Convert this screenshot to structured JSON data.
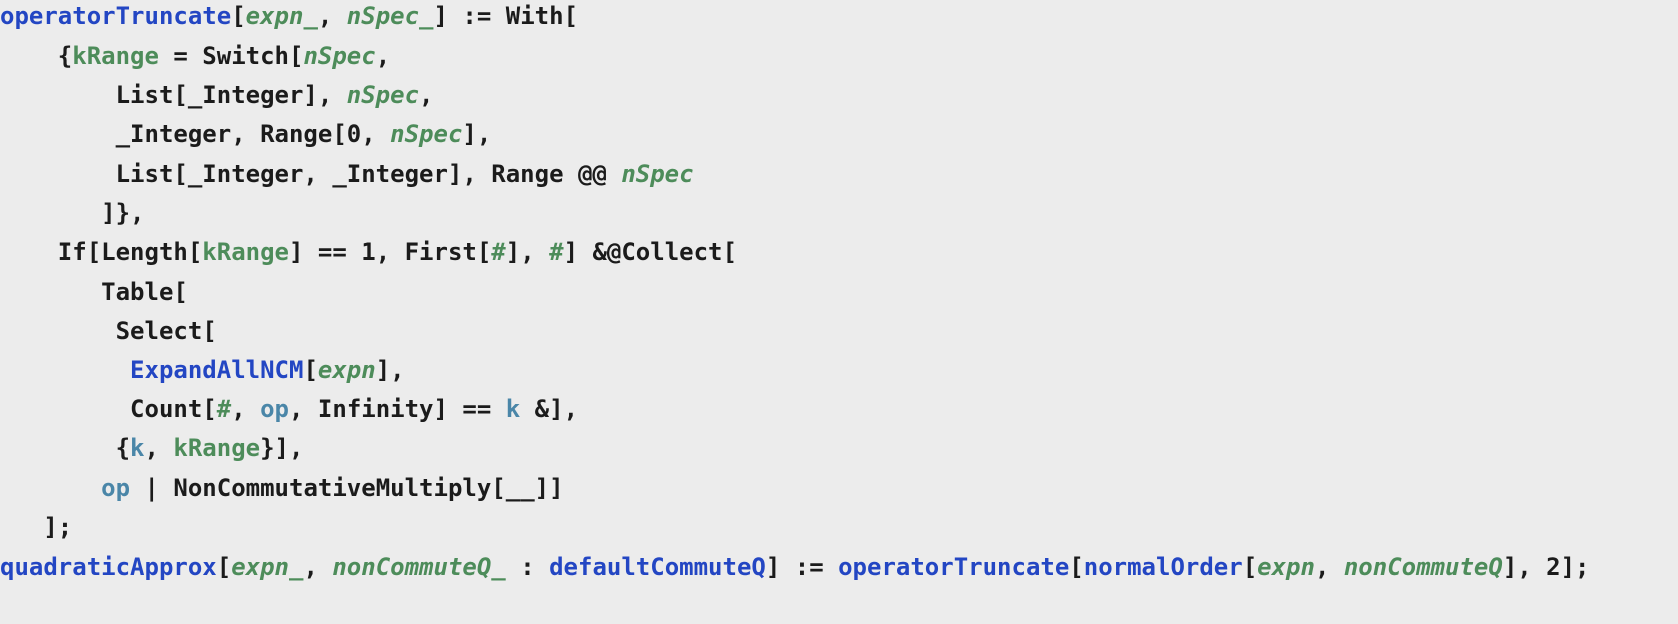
{
  "code": {
    "lines": [
      [
        {
          "t": "operatorTruncate",
          "c": "blue"
        },
        {
          "t": "[",
          "c": "plain"
        },
        {
          "t": "expn_",
          "c": "green-italic"
        },
        {
          "t": ", ",
          "c": "plain"
        },
        {
          "t": "nSpec_",
          "c": "green-italic"
        },
        {
          "t": "] := With[",
          "c": "plain"
        }
      ],
      [
        {
          "t": "    {",
          "c": "plain"
        },
        {
          "t": "kRange",
          "c": "green"
        },
        {
          "t": " = Switch[",
          "c": "plain"
        },
        {
          "t": "nSpec",
          "c": "green-italic"
        },
        {
          "t": ",",
          "c": "plain"
        }
      ],
      [
        {
          "t": "        List[_Integer], ",
          "c": "plain"
        },
        {
          "t": "nSpec",
          "c": "green-italic"
        },
        {
          "t": ",",
          "c": "plain"
        }
      ],
      [
        {
          "t": "        _Integer, Range[0, ",
          "c": "plain"
        },
        {
          "t": "nSpec",
          "c": "green-italic"
        },
        {
          "t": "],",
          "c": "plain"
        }
      ],
      [
        {
          "t": "        List[_Integer, _Integer], Range @@ ",
          "c": "plain"
        },
        {
          "t": "nSpec",
          "c": "green-italic"
        }
      ],
      [
        {
          "t": "       ]},",
          "c": "plain"
        }
      ],
      [
        {
          "t": "    If[Length[",
          "c": "plain"
        },
        {
          "t": "kRange",
          "c": "green"
        },
        {
          "t": "] == 1, First[",
          "c": "plain"
        },
        {
          "t": "#",
          "c": "green"
        },
        {
          "t": "], ",
          "c": "plain"
        },
        {
          "t": "#",
          "c": "green"
        },
        {
          "t": "] &@Collect[",
          "c": "plain"
        }
      ],
      [
        {
          "t": "       Table[",
          "c": "plain"
        }
      ],
      [
        {
          "t": "        Select[",
          "c": "plain"
        }
      ],
      [
        {
          "t": "         ",
          "c": "plain"
        },
        {
          "t": "ExpandAllNCM",
          "c": "blue"
        },
        {
          "t": "[",
          "c": "plain"
        },
        {
          "t": "expn",
          "c": "green-italic"
        },
        {
          "t": "],",
          "c": "plain"
        }
      ],
      [
        {
          "t": "         Count[",
          "c": "plain"
        },
        {
          "t": "#",
          "c": "green"
        },
        {
          "t": ", ",
          "c": "plain"
        },
        {
          "t": "op",
          "c": "teal"
        },
        {
          "t": ", Infinity] == ",
          "c": "plain"
        },
        {
          "t": "k",
          "c": "teal"
        },
        {
          "t": " &],",
          "c": "plain"
        }
      ],
      [
        {
          "t": "        {",
          "c": "plain"
        },
        {
          "t": "k",
          "c": "teal"
        },
        {
          "t": ", ",
          "c": "plain"
        },
        {
          "t": "kRange",
          "c": "green"
        },
        {
          "t": "}],",
          "c": "plain"
        }
      ],
      [
        {
          "t": "       ",
          "c": "plain"
        },
        {
          "t": "op",
          "c": "teal"
        },
        {
          "t": " | NonCommutativeMultiply[__]]",
          "c": "plain"
        }
      ],
      [
        {
          "t": "   ];",
          "c": "plain"
        }
      ],
      [
        {
          "t": "quadraticApprox",
          "c": "blue"
        },
        {
          "t": "[",
          "c": "plain"
        },
        {
          "t": "expn_",
          "c": "green-italic"
        },
        {
          "t": ", ",
          "c": "plain"
        },
        {
          "t": "nonCommuteQ_",
          "c": "green-italic"
        },
        {
          "t": " : ",
          "c": "plain"
        },
        {
          "t": "defaultCommuteQ",
          "c": "blue"
        },
        {
          "t": "] := ",
          "c": "plain"
        },
        {
          "t": "operatorTruncate",
          "c": "blue"
        },
        {
          "t": "[",
          "c": "plain"
        },
        {
          "t": "normalOrder",
          "c": "blue"
        },
        {
          "t": "[",
          "c": "plain"
        },
        {
          "t": "expn",
          "c": "green-italic"
        },
        {
          "t": ", ",
          "c": "plain"
        },
        {
          "t": "nonCommuteQ",
          "c": "green-italic"
        },
        {
          "t": "], 2];",
          "c": "plain"
        }
      ]
    ]
  }
}
